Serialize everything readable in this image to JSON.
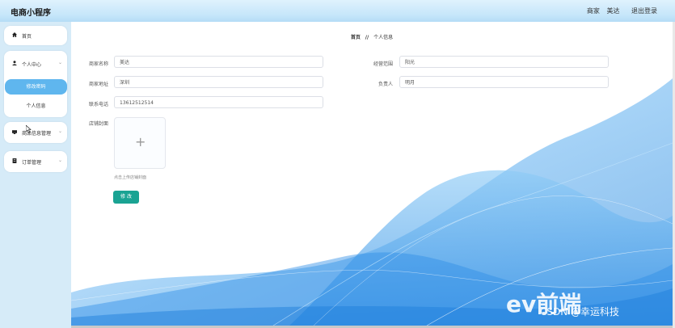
{
  "header": {
    "app_title": "电商小程序",
    "role": "商家",
    "username": "美达",
    "logout_label": "退出登录"
  },
  "sidebar": {
    "home_label": "首页",
    "personal_center_label": "个人中心",
    "change_password_label": "修改密码",
    "personal_info_label": "个人信息",
    "product_manage_label": "商品信息管理",
    "order_manage_label": "订单管理"
  },
  "breadcrumb": {
    "home": "首页",
    "separator": "//",
    "current": "个人信息"
  },
  "form": {
    "merchant_name_label": "商家名称",
    "merchant_name_value": "美达",
    "business_scope_label": "经营范围",
    "business_scope_value": "阳光",
    "merchant_address_label": "商家地址",
    "merchant_address_value": "深圳",
    "person_in_charge_label": "负责人",
    "person_in_charge_value": "明月",
    "phone_label": "联系电话",
    "phone_value": "13612512514",
    "store_cover_label": "店铺封面",
    "upload_hint": "点击上传店铺封面",
    "submit_label": "修 改"
  },
  "watermark": {
    "brand": "ev前端",
    "csdn": "CSDN @幸运科技"
  },
  "colors": {
    "accent": "#1aa393",
    "active_menu": "#5fb6ee",
    "sidebar_bg": "#d6ebf8",
    "header_bg": "#c6e6fa",
    "wave": "#2f8fe6"
  }
}
